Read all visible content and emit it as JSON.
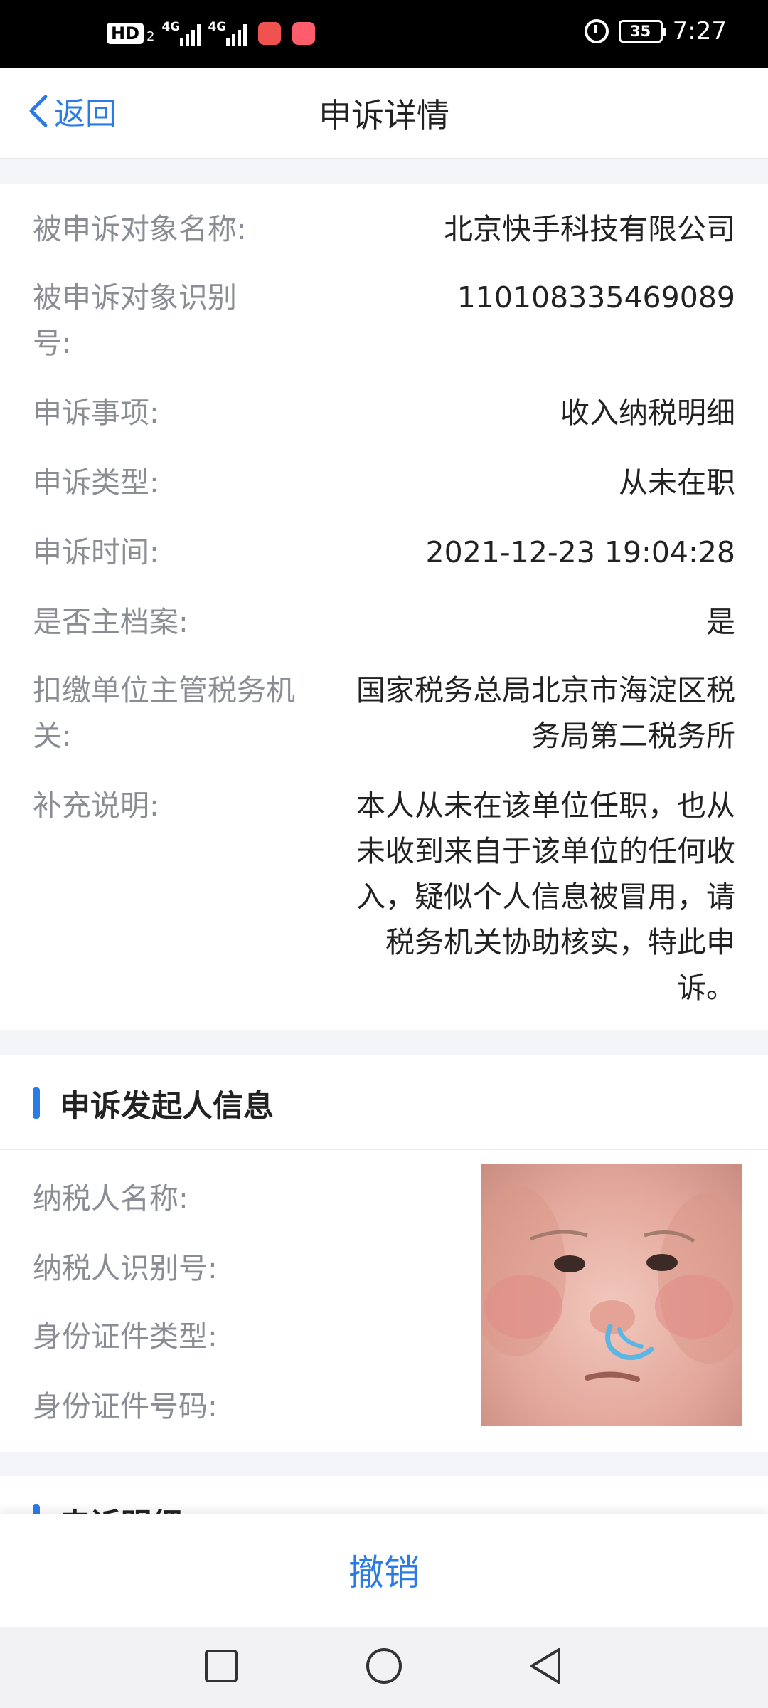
{
  "status_bar": {
    "hd": "HD",
    "hd_sub": "2",
    "net1": "4G",
    "net2": "4G",
    "battery": "35",
    "time": "7:27"
  },
  "nav": {
    "back_label": "返回",
    "title": "申诉详情"
  },
  "details": [
    {
      "label": "被申诉对象名称:",
      "value": "北京快手科技有限公司"
    },
    {
      "label": "被申诉对象识别号:",
      "value": "110108335469089"
    },
    {
      "label": "申诉事项:",
      "value": "收入纳税明细"
    },
    {
      "label": "申诉类型:",
      "value": "从未在职"
    },
    {
      "label": "申诉时间:",
      "value": "2021-12-23 19:04:28"
    },
    {
      "label": "是否主档案:",
      "value": "是"
    },
    {
      "label": "扣缴单位主管税务机关:",
      "value": "国家税务总局北京市海淀区税务局第二税务所"
    },
    {
      "label": "补充说明:",
      "value": "本人从未在该单位任职，也从未收到来自于该单位的任何收入，疑似个人信息被冒用，请税务机关协助核实，特此申诉。"
    }
  ],
  "initiator": {
    "section_title": "申诉发起人信息",
    "labels": [
      "纳税人名称:",
      "纳税人识别号:",
      "身份证件类型:",
      "身份证件号码:"
    ]
  },
  "next_section": {
    "title": "申诉明细"
  },
  "actions": {
    "revoke_label": "撤销"
  },
  "colors": {
    "accent": "#2b7be6",
    "label_gray": "#8a8d93",
    "page_bg": "#f3f5f8"
  }
}
